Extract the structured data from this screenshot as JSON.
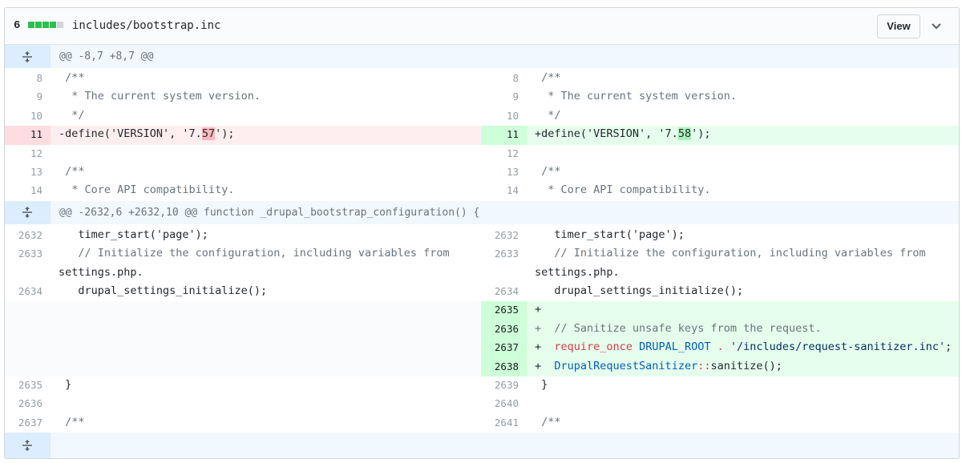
{
  "file": {
    "changes": "6",
    "diffstat_colors": [
      "#2cbe4e",
      "#2cbe4e",
      "#2cbe4e",
      "#2cbe4e",
      "#d1d5da"
    ],
    "path": "includes/bootstrap.inc",
    "view_label": "View",
    "chevron_icon": "chevron-down-icon",
    "expand_icon": "unfold-icon"
  },
  "hunks": [
    {
      "header": "@@ -8,7 +8,7 @@"
    },
    {
      "header": "@@ -2632,6 +2632,10 @@ function _drupal_bootstrap_configuration() {"
    }
  ],
  "left": {
    "h1": [
      {
        "n": "8",
        "t": " /**"
      },
      {
        "n": "9",
        "t": "  * The current system version."
      },
      {
        "n": "10",
        "t": "  */"
      },
      {
        "n": "11",
        "pre": "-define('VERSION', '7.",
        "hl": "57",
        "post": "');"
      },
      {
        "n": "12",
        "t": ""
      },
      {
        "n": "13",
        "t": " /**"
      },
      {
        "n": "14",
        "t": "  * Core API compatibility."
      }
    ],
    "h2": [
      {
        "n": "2632",
        "t": "   timer_start('page');"
      },
      {
        "n": "2633",
        "t1": "   // Initialize the configuration, including variables from",
        "t2": "settings.php."
      },
      {
        "n": "2634",
        "t": "   drupal_settings_initialize();"
      },
      {
        "n": "2635",
        "t": " }"
      },
      {
        "n": "2636",
        "t": ""
      },
      {
        "n": "2637",
        "t": " /**"
      }
    ]
  },
  "right": {
    "h1": [
      {
        "n": "8",
        "t": " /**"
      },
      {
        "n": "9",
        "t": "  * The current system version."
      },
      {
        "n": "10",
        "t": "  */"
      },
      {
        "n": "11",
        "pre": "+define('VERSION', '7.",
        "hl": "58",
        "post": "');"
      },
      {
        "n": "12",
        "t": ""
      },
      {
        "n": "13",
        "t": " /**"
      },
      {
        "n": "14",
        "t": "  * Core API compatibility."
      }
    ],
    "h2": [
      {
        "n": "2632",
        "t": "   timer_start('page');"
      },
      {
        "n": "2633",
        "t1": "   // Initialize the configuration, including variables from",
        "t2": "settings.php."
      },
      {
        "n": "2634",
        "t": "   drupal_settings_initialize();"
      },
      {
        "n": "2635",
        "t": "+"
      },
      {
        "n": "2636",
        "t": "+  // Sanitize unsafe keys from the request."
      },
      {
        "n": "2637",
        "p1": "+  ",
        "kw": "require_once",
        "sp": " ",
        "c1": "DRUPAL_ROOT",
        "op": " . ",
        "s": "'/includes/request-sanitizer.inc'",
        "end": ";"
      },
      {
        "n": "2638",
        "p1": "+  ",
        "c1": "DrupalRequestSanitizer",
        "kw": "::",
        "post": "sanitize();"
      },
      {
        "n": "2639",
        "t": " }"
      },
      {
        "n": "2640",
        "t": ""
      },
      {
        "n": "2641",
        "t": " /**"
      }
    ]
  }
}
